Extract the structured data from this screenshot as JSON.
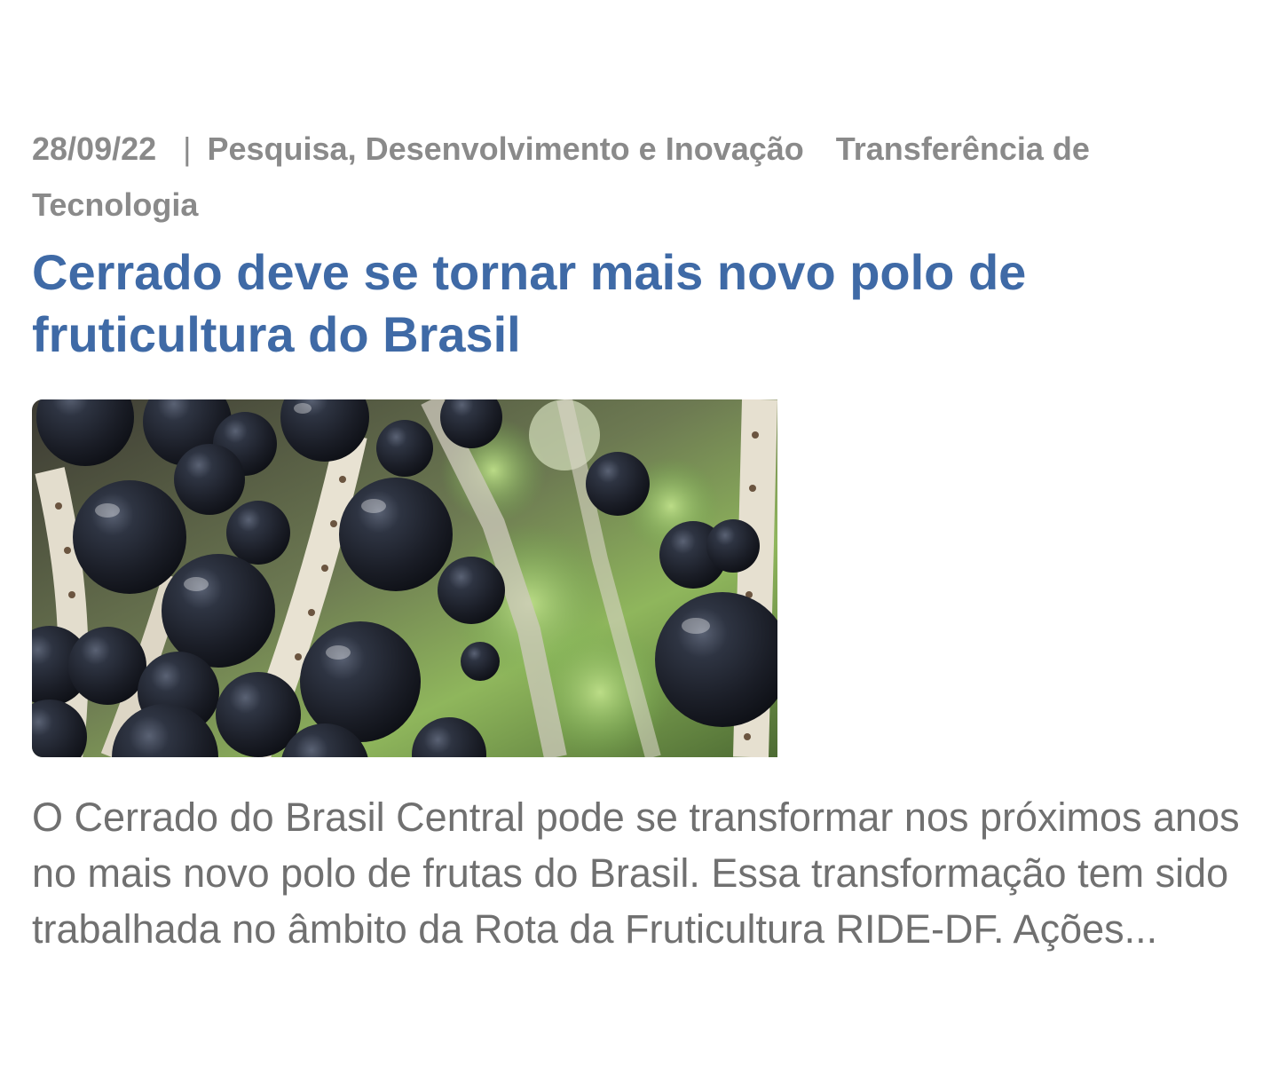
{
  "post": {
    "date": "28/09/22",
    "separator": "|",
    "categories": [
      "Pesquisa, Desenvolvimento e Inovação",
      "Transferência de Tecnologia"
    ],
    "title": "Cerrado deve se tornar mais novo polo de fruticultura do Brasil",
    "image_subject": "acai-berries-cluster-photo",
    "excerpt": "O Cerrado do Brasil Central pode se transformar nos próximos anos no mais novo polo de frutas do Brasil. Essa transformação tem sido trabalhada no âmbito da Rota da Fruticultura RIDE-DF. Ações..."
  },
  "colors": {
    "title": "#3f6aa6",
    "meta": "#8a8a8a",
    "excerpt": "#707070",
    "background": "#ffffff"
  }
}
